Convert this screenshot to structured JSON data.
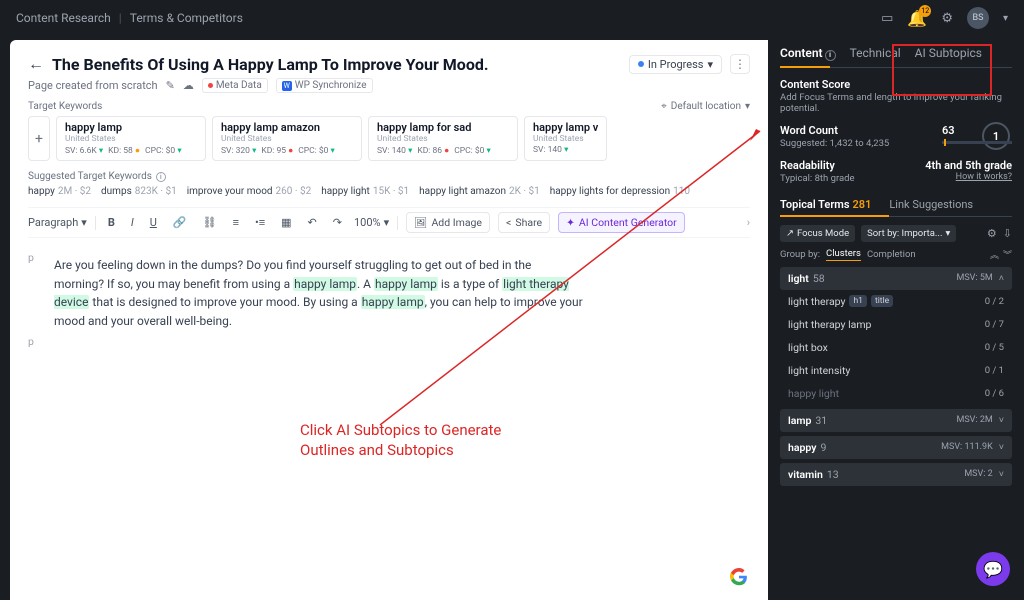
{
  "topbar": {
    "crumb1": "Content Research",
    "crumb2": "Terms & Competitors",
    "badge_count": "12",
    "avatar": "BS"
  },
  "page": {
    "title": "The Benefits Of Using A Happy Lamp To Improve Your Mood.",
    "subtitle": "Page created from scratch",
    "meta_chip": "Meta Data",
    "wp_chip": "WP Synchronize",
    "status": "In Progress",
    "target_keywords_label": "Target Keywords",
    "location_label": "Default location"
  },
  "keyword_cards": [
    {
      "name": "happy lamp",
      "loc": "United States",
      "sv": "SV: 6.6K",
      "kd": "KD: 58",
      "kd_color": "dot-o",
      "cpc": "CPC: $0"
    },
    {
      "name": "happy lamp amazon",
      "loc": "United States",
      "sv": "SV: 320",
      "kd": "KD: 95",
      "kd_color": "dot-r",
      "cpc": "CPC: $0"
    },
    {
      "name": "happy lamp for sad",
      "loc": "United States",
      "sv": "SV: 140",
      "kd": "KD: 86",
      "kd_color": "dot-r",
      "cpc": "CPC: $0"
    },
    {
      "name": "happy lamp v",
      "loc": "United States",
      "sv": "SV: 140",
      "kd": "",
      "kd_color": "",
      "cpc": ""
    }
  ],
  "suggested": {
    "label": "Suggested Target Keywords",
    "items": [
      {
        "t": "happy",
        "sub": "2M · $2"
      },
      {
        "t": "dumps",
        "sub": "823K · $1"
      },
      {
        "t": "improve your mood",
        "sub": "260 · $2"
      },
      {
        "t": "happy light",
        "sub": "15K · $1"
      },
      {
        "t": "happy light amazon",
        "sub": "2K · $1"
      },
      {
        "t": "happy lights for depression",
        "sub": "110"
      }
    ]
  },
  "toolbar": {
    "paragraph": "Paragraph",
    "zoom": "100%",
    "add_image": "Add Image",
    "share": "Share",
    "ai": "AI Content Generator"
  },
  "content": {
    "p1a": "Are you feeling down in the dumps? Do you find yourself struggling to get out of bed in the morning? If so, you may benefit from using a ",
    "hl1": "happy lamp",
    "p1b": ". A ",
    "hl2": "happy lamp",
    "p1c": " is a type of ",
    "hl3": "light therapy device",
    "p1d": " that is designed to improve your mood. By using a ",
    "hl4": "happy lamp",
    "p1e": ", you can help to improve your mood and your overall well-being.",
    "p_tag": "p"
  },
  "annotation": {
    "line1": "Click AI Subtopics to Generate",
    "line2": "Outlines and Subtopics"
  },
  "side": {
    "tabs": {
      "content": "Content",
      "technical": "Technical",
      "ai": "AI Subtopics"
    },
    "score": {
      "label": "Content Score",
      "value": "1",
      "sub": "Add Focus Terms and length to improve your ranking potential."
    },
    "wordcount": {
      "label": "Word Count",
      "value": "63",
      "sub": "Suggested: 1,432 to 4,235"
    },
    "readability": {
      "label": "Readability",
      "value": "4th and 5th grade",
      "sub": "Typical: 8th grade",
      "link": "How it works?"
    },
    "tabs2": {
      "terms": "Topical Terms",
      "terms_count": "281",
      "links": "Link Suggestions"
    },
    "controls": {
      "focus": "Focus Mode",
      "sort": "Sort by: Importa..."
    },
    "group": {
      "label": "Group by:",
      "clusters": "Clusters",
      "completion": "Completion"
    },
    "terms": [
      {
        "type": "header",
        "name": "light",
        "count": "58",
        "msv": "MSV: 5M",
        "open": true
      },
      {
        "type": "row",
        "name": "light therapy",
        "badges": [
          "h1",
          "title"
        ],
        "score": "0 / 2"
      },
      {
        "type": "row",
        "name": "light therapy lamp",
        "score": "0 / 7"
      },
      {
        "type": "row",
        "name": "light box",
        "score": "0 / 5"
      },
      {
        "type": "row",
        "name": "light intensity",
        "score": "0 / 1"
      },
      {
        "type": "row",
        "name": "happy light",
        "score": "0 / 6",
        "muted": true
      },
      {
        "type": "header",
        "name": "lamp",
        "count": "31",
        "msv": "MSV: 2M",
        "open": false
      },
      {
        "type": "header",
        "name": "happy",
        "count": "9",
        "msv": "MSV: 111.9K",
        "open": false
      },
      {
        "type": "header",
        "name": "vitamin",
        "count": "13",
        "msv": "MSV: 2",
        "open": false
      }
    ]
  }
}
